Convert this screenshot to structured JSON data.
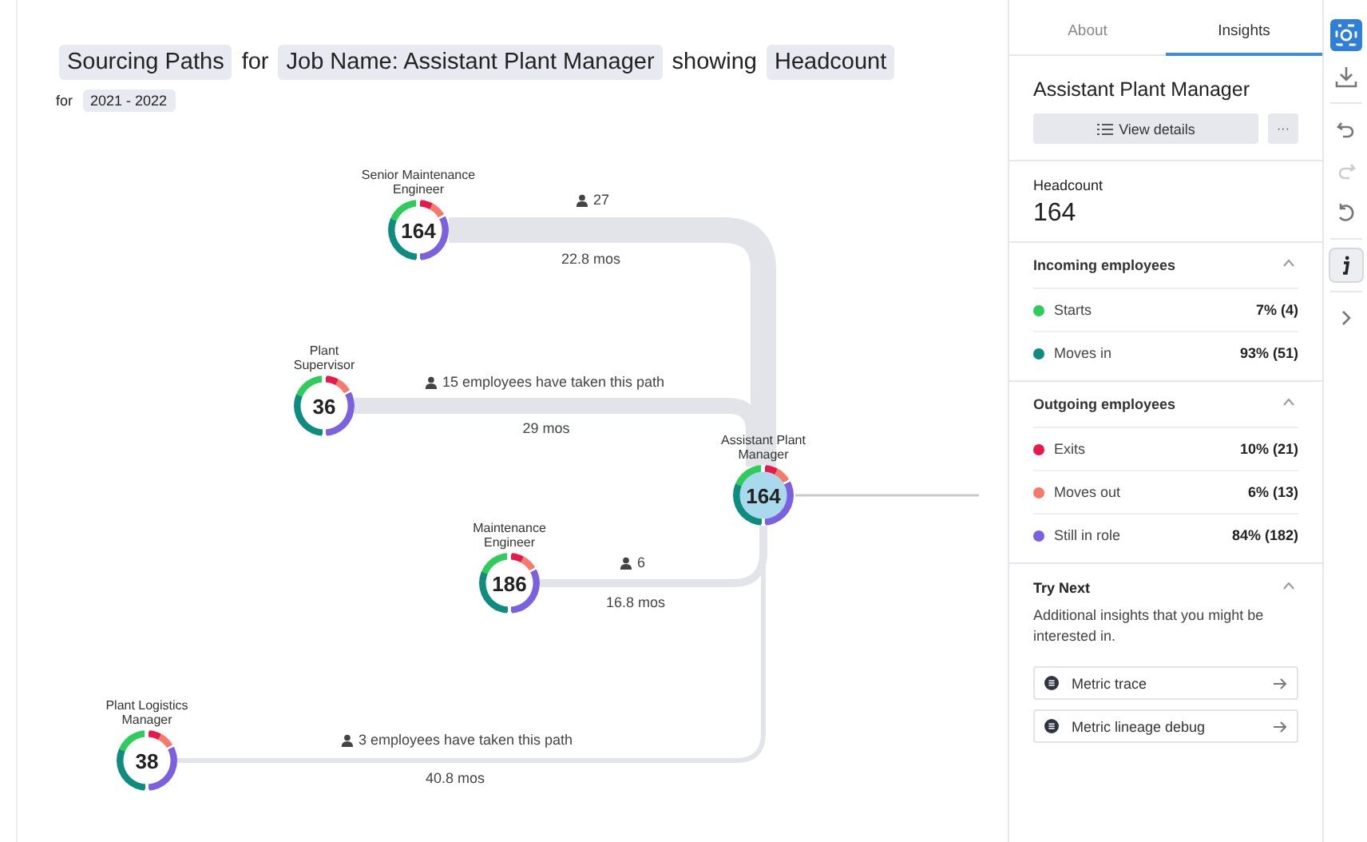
{
  "header": {
    "parts": [
      {
        "kind": "chip",
        "text": "Sourcing Paths"
      },
      {
        "kind": "word",
        "text": "for"
      },
      {
        "kind": "chip",
        "text": "Job Name: Assistant Plant Manager"
      },
      {
        "kind": "word",
        "text": "showing"
      },
      {
        "kind": "chip",
        "text": "Headcount"
      }
    ],
    "period": [
      {
        "kind": "word",
        "text": "for"
      },
      {
        "kind": "chip",
        "text": "2021 - 2022"
      }
    ]
  },
  "diagram": {
    "nodes": [
      {
        "label": "Senior Maintenance Engineer",
        "value": "164",
        "selected": false
      },
      {
        "label": "Plant Supervisor",
        "value": "36",
        "selected": false
      },
      {
        "label": "Assistant Plant Manager",
        "value": "164",
        "selected": true
      },
      {
        "label": "Maintenance Engineer",
        "value": "186",
        "selected": false
      },
      {
        "label": "Plant Logistics Manager",
        "value": "38",
        "selected": false
      }
    ],
    "paths": [
      {
        "count": "27",
        "duration": "22.8 mos"
      },
      {
        "count": "15 employees have taken this path",
        "duration": "29 mos"
      },
      {
        "count": "6",
        "duration": "16.8 mos"
      },
      {
        "count": "3 employees have taken this path",
        "duration": "40.8 mos"
      }
    ]
  },
  "panel": {
    "tabs": [
      {
        "label": "About",
        "selected": false
      },
      {
        "label": "Insights",
        "selected": true
      }
    ],
    "title": "Assistant Plant Manager",
    "view_button": "View details",
    "more_button": "···",
    "metric": {
      "label": "Headcount",
      "value": "164"
    },
    "sections": [
      {
        "title": "Incoming employees",
        "expanded": true,
        "items": [
          {
            "label": "Starts",
            "value": "7% (4)",
            "color": "#2ecc5a"
          },
          {
            "label": "Moves in",
            "value": "93% (51)",
            "color": "#0e8c7f"
          }
        ]
      },
      {
        "title": "Outgoing employees",
        "expanded": true,
        "items": [
          {
            "label": "Exits",
            "value": "10% (21)",
            "color": "#e8184a"
          },
          {
            "label": "Moves out",
            "value": "6% (13)",
            "color": "#f57a6a"
          },
          {
            "label": "Still in role",
            "value": "84% (182)",
            "color": "#7b61e0"
          }
        ]
      }
    ],
    "try_next": {
      "title": "Try Next",
      "expanded": true,
      "description": "Additional insights that you might be interested in.",
      "links": [
        "Metric trace",
        "Metric lineage debug"
      ]
    }
  },
  "toolbar": [
    {
      "kind": "focus",
      "selected": true,
      "pressed": false,
      "disabled": false
    },
    {
      "kind": "download",
      "selected": false,
      "pressed": false,
      "disabled": false
    },
    {
      "kind": "undo",
      "selected": false,
      "pressed": false,
      "disabled": false
    },
    {
      "kind": "redo",
      "selected": false,
      "pressed": false,
      "disabled": true
    },
    {
      "kind": "reset",
      "selected": false,
      "pressed": false,
      "disabled": false
    },
    {
      "kind": "info",
      "selected": false,
      "pressed": true,
      "disabled": false
    },
    {
      "kind": "expand",
      "selected": false,
      "pressed": false,
      "disabled": false
    }
  ]
}
